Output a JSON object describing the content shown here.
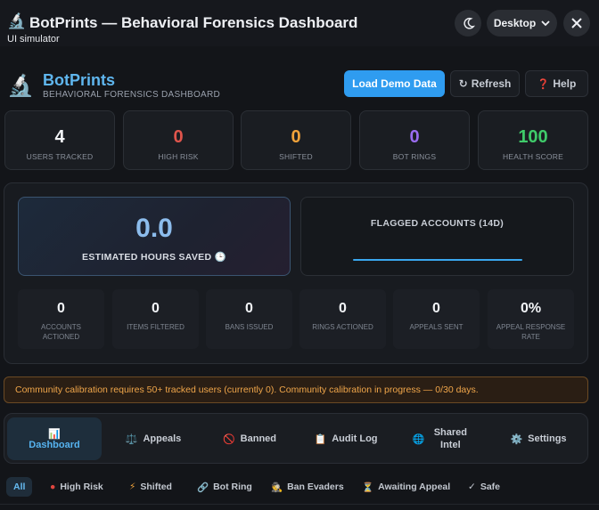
{
  "window": {
    "title": "BotPrints — Behavioral Forensics Dashboard",
    "subtitle": "UI simulator",
    "title_icon": "🔬",
    "device_label": "Desktop",
    "theme_icon": "moon-icon",
    "close_icon": "close-icon"
  },
  "header": {
    "brand_icon": "🔬",
    "brand_name": "BotPrints",
    "tagline": "BEHAVIORAL FORENSICS DASHBOARD",
    "load_demo_label": "Load Demo Data",
    "refresh_label": "Refresh",
    "refresh_glyph": "↻",
    "help_label": "Help",
    "help_glyph": "❓"
  },
  "stats": [
    {
      "value": "4",
      "label": "USERS TRACKED",
      "color": "#f2f4f7"
    },
    {
      "value": "0",
      "label": "HIGH RISK",
      "color": "#e0554c"
    },
    {
      "value": "0",
      "label": "SHIFTED",
      "color": "#f0a23a"
    },
    {
      "value": "0",
      "label": "BOT RINGS",
      "color": "#9a6cf0"
    },
    {
      "value": "100",
      "label": "HEALTH SCORE",
      "color": "#3fcb6a"
    }
  ],
  "impact": {
    "hours_value": "0.0",
    "hours_label": "ESTIMATED HOURS SAVED",
    "hours_glyph": "🕒",
    "flagged_label": "FLAGGED ACCOUNTS (14D)",
    "metrics": [
      {
        "value": "0",
        "label": "ACCOUNTS ACTIONED"
      },
      {
        "value": "0",
        "label": "ITEMS FILTERED"
      },
      {
        "value": "0",
        "label": "BANS ISSUED"
      },
      {
        "value": "0",
        "label": "RINGS ACTIONED"
      },
      {
        "value": "0",
        "label": "APPEALS SENT"
      },
      {
        "value": "0%",
        "label": "APPEAL RESPONSE RATE"
      }
    ]
  },
  "banner": {
    "text": "Community calibration requires 50+ tracked users (currently 0). Community calibration in progress — 0/30 days."
  },
  "tabs": [
    {
      "icon": "📊",
      "label": "Dashboard",
      "active": true
    },
    {
      "icon": "⚖️",
      "label": "Appeals"
    },
    {
      "icon": "🚫",
      "label": "Banned"
    },
    {
      "icon": "📋",
      "label": "Audit Log"
    },
    {
      "icon": "🌐",
      "label": "Shared Intel"
    },
    {
      "icon": "⚙️",
      "label": "Settings"
    }
  ],
  "filters": [
    {
      "label": "All",
      "glyph": ""
    },
    {
      "label": "High Risk",
      "glyph": "●"
    },
    {
      "label": "Shifted",
      "glyph": "⚡"
    },
    {
      "label": "Bot Ring",
      "glyph": "🔗"
    },
    {
      "label": "Ban Evaders",
      "glyph": "🕵"
    },
    {
      "label": "Awaiting Appeal",
      "glyph": "⏳"
    },
    {
      "label": "Safe",
      "glyph": "✓"
    }
  ]
}
